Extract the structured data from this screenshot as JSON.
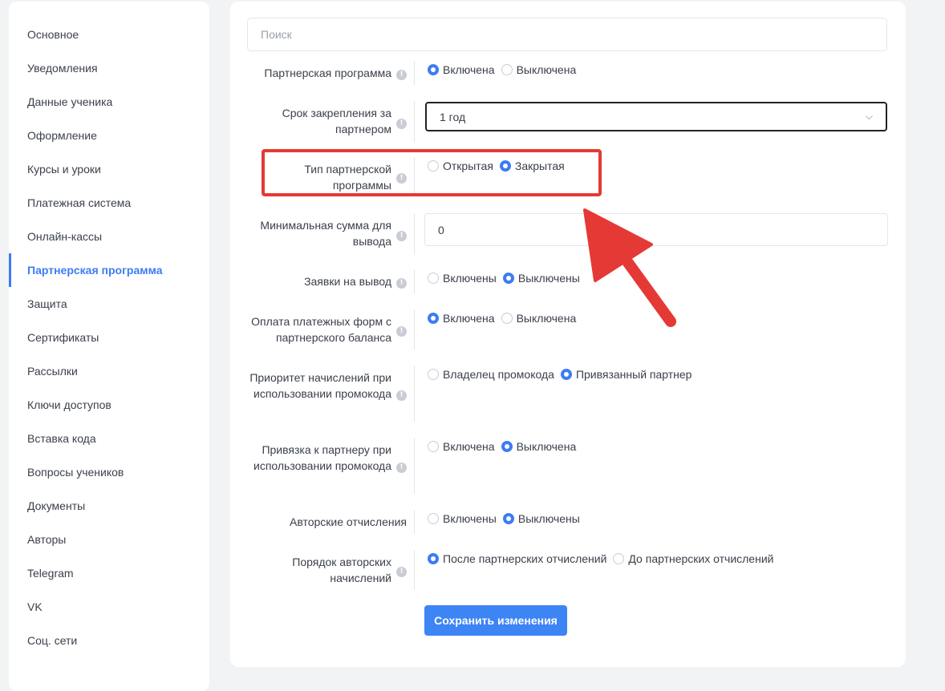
{
  "sidebar": {
    "items": [
      {
        "label": "Основное",
        "active": false
      },
      {
        "label": "Уведомления",
        "active": false
      },
      {
        "label": "Данные ученика",
        "active": false
      },
      {
        "label": "Оформление",
        "active": false
      },
      {
        "label": "Курсы и уроки",
        "active": false
      },
      {
        "label": "Платежная система",
        "active": false
      },
      {
        "label": "Онлайн-кассы",
        "active": false
      },
      {
        "label": "Партнерская программа",
        "active": true
      },
      {
        "label": "Защита",
        "active": false
      },
      {
        "label": "Сертификаты",
        "active": false
      },
      {
        "label": "Рассылки",
        "active": false
      },
      {
        "label": "Ключи доступов",
        "active": false
      },
      {
        "label": "Вставка кода",
        "active": false
      },
      {
        "label": "Вопросы учеников",
        "active": false
      },
      {
        "label": "Документы",
        "active": false
      },
      {
        "label": "Авторы",
        "active": false
      },
      {
        "label": "Telegram",
        "active": false
      },
      {
        "label": "VK",
        "active": false
      },
      {
        "label": "Соц. сети",
        "active": false
      }
    ]
  },
  "search": {
    "placeholder": "Поиск"
  },
  "settings": {
    "partner_program": {
      "label": "Партнерская программа",
      "options": [
        {
          "label": "Включена",
          "selected": true
        },
        {
          "label": "Выключена",
          "selected": false
        }
      ]
    },
    "binding_period": {
      "label": "Срок закрепления за партнером",
      "value": "1 год"
    },
    "program_type": {
      "label": "Тип партнерской программы",
      "options": [
        {
          "label": "Открытая",
          "selected": false
        },
        {
          "label": "Закрытая",
          "selected": true
        }
      ]
    },
    "min_withdrawal": {
      "label": "Минимальная сумма для вывода",
      "value": "0"
    },
    "withdrawal_requests": {
      "label": "Заявки на вывод",
      "options": [
        {
          "label": "Включены",
          "selected": false
        },
        {
          "label": "Выключены",
          "selected": true
        }
      ]
    },
    "pay_from_balance": {
      "label": "Оплата платежных форм с партнерского баланса",
      "options": [
        {
          "label": "Включена",
          "selected": true
        },
        {
          "label": "Выключена",
          "selected": false
        }
      ]
    },
    "accrual_priority": {
      "label": "Приоритет начислений при использовании промокода",
      "options": [
        {
          "label": "Владелец промокода",
          "selected": false
        },
        {
          "label": "Привязанный партнер",
          "selected": true
        }
      ]
    },
    "partner_binding": {
      "label": "Привязка к партнеру при использовании промокода",
      "options": [
        {
          "label": "Включена",
          "selected": false
        },
        {
          "label": "Выключена",
          "selected": true
        }
      ]
    },
    "author_deductions": {
      "label": "Авторские отчисления",
      "options": [
        {
          "label": "Включены",
          "selected": false
        },
        {
          "label": "Выключены",
          "selected": true
        }
      ]
    },
    "author_order": {
      "label": "Порядок авторских начислений",
      "options": [
        {
          "label": "После партнерских отчислений",
          "selected": true
        },
        {
          "label": "До партнерских отчислений",
          "selected": false
        }
      ]
    }
  },
  "save_button": {
    "label": "Сохранить изменения"
  },
  "info_glyph": "!",
  "select_chevron": "⌵",
  "colors": {
    "accent": "#3d7cf3",
    "annotation": "#e53935"
  }
}
